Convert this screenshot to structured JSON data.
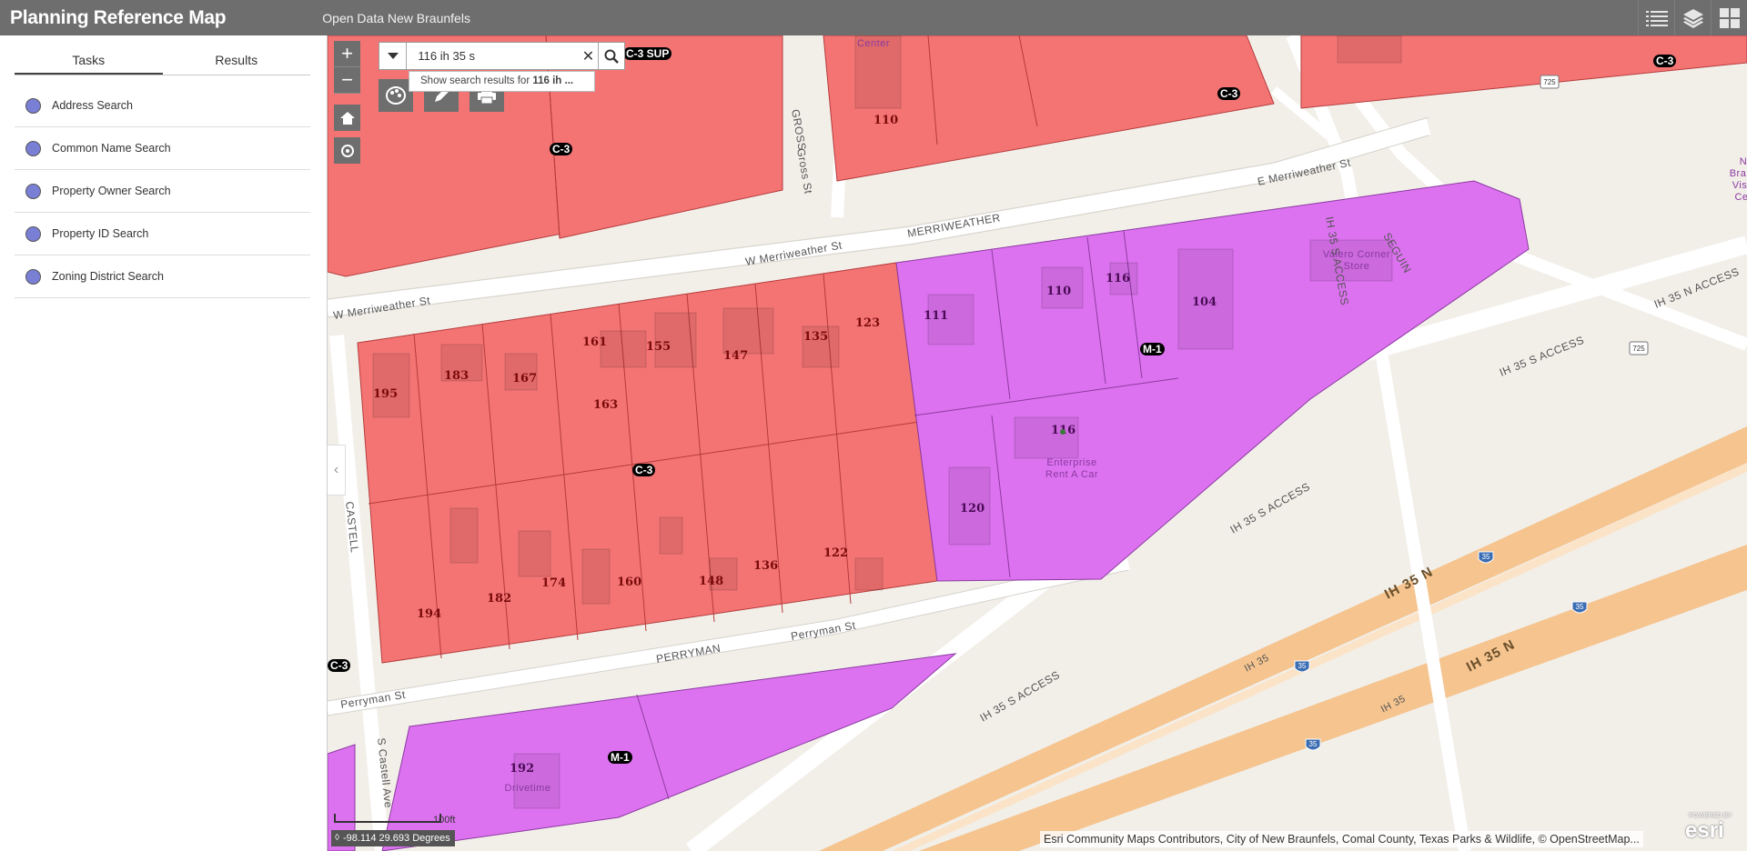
{
  "header": {
    "title": "Planning Reference Map",
    "subtitle": "Open Data New Braunfels",
    "tools": [
      "list-icon",
      "layers-icon",
      "grid-icon"
    ]
  },
  "sidebar": {
    "tabs": [
      {
        "label": "Tasks",
        "active": true
      },
      {
        "label": "Results",
        "active": false
      }
    ],
    "tasks": [
      {
        "label": "Address Search"
      },
      {
        "label": "Common Name Search"
      },
      {
        "label": "Property Owner Search"
      },
      {
        "label": "Property ID Search"
      },
      {
        "label": "Zoning District Search"
      }
    ]
  },
  "search": {
    "value": "116 ih 35 s",
    "suggestion_prefix": "Show search results for ",
    "suggestion_term": "116 ih ..."
  },
  "map": {
    "zone_labels": [
      "C-3",
      "C-3",
      "C-3",
      "C-3",
      "C-3",
      "M-1",
      "M-1",
      "C-3 SUP"
    ],
    "parcels_c3": [
      "110",
      "195",
      "183",
      "167",
      "161",
      "163",
      "155",
      "147",
      "135",
      "123",
      "194",
      "182",
      "174",
      "160",
      "148",
      "136",
      "122"
    ],
    "parcels_m1": [
      "111",
      "110",
      "116",
      "104",
      "116",
      "120",
      "192"
    ],
    "streets": [
      "W Merriweather St",
      "W Merriweather St",
      "MERRIWEATHER",
      "E Merriweather St",
      "GROSS",
      "Gross St",
      "CASTELL",
      "S Castell Ave",
      "PERRYMAN",
      "Perryman St",
      "Perryman St",
      "IH 35 S ACCESS",
      "IH 35 S ACCESS",
      "IH 35 S ACCESS",
      "IH 35 S ACCESS",
      "IH 35 N ACCESS",
      "SEGUIN",
      "IH 35 N",
      "IH 35 N",
      "IH 35",
      "IH 35"
    ],
    "poi": [
      "Valero Corner",
      "Store",
      "Enterprise",
      "Rent A Car",
      "Drivetime",
      "Center",
      "N",
      "Bra",
      "Vis",
      "Ce"
    ],
    "shields": [
      "725",
      "725",
      "35",
      "35",
      "35",
      "35"
    ],
    "colors": {
      "c3": "#f47474",
      "m1": "#dd72f0",
      "highway": "#f5c48f",
      "road": "#ffffff",
      "ground": "#f2efe9"
    }
  },
  "footer": {
    "scale": "100ft",
    "coords": "-98.114 29.693 Degrees",
    "attribution": "Esri Community Maps Contributors, City of New Braunfels, Comal County, Texas Parks & Wildlife, © OpenStreetMap...",
    "logo": "esri",
    "powered": "POWERED BY"
  }
}
